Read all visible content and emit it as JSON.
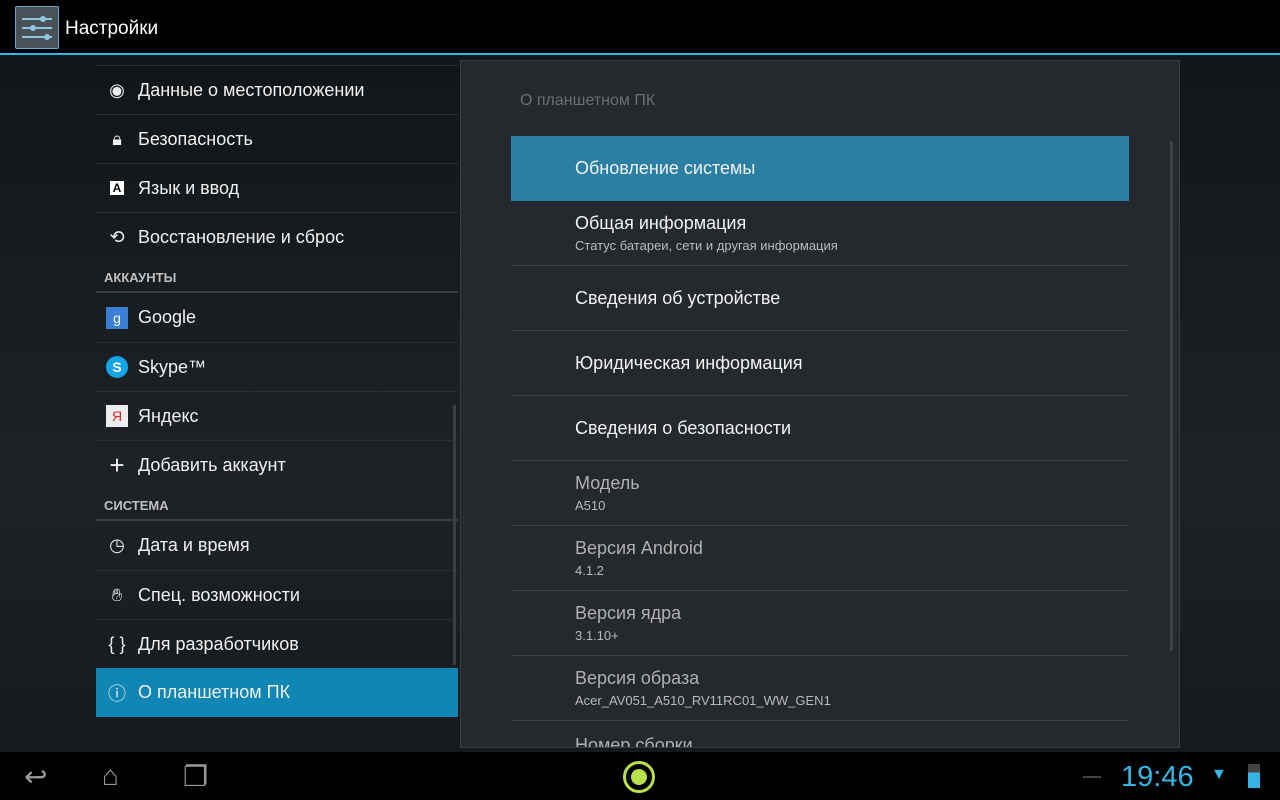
{
  "app": {
    "title": "Настройки"
  },
  "left": {
    "items": [
      {
        "label": "Данные о местоположении",
        "icon": "location-icon"
      },
      {
        "label": "Безопасность",
        "icon": "lock-icon"
      },
      {
        "label": "Язык и ввод",
        "icon": "keyboard-a-icon"
      },
      {
        "label": "Восстановление и сброс",
        "icon": "restore-icon"
      }
    ],
    "accounts_header": "АККАУНТЫ",
    "accounts": [
      {
        "label": "Google",
        "icon": "google-icon"
      },
      {
        "label": "Skype™",
        "icon": "skype-icon"
      },
      {
        "label": "Яндекс",
        "icon": "yandex-icon"
      },
      {
        "label": "Добавить аккаунт",
        "icon": "plus-icon"
      }
    ],
    "system_header": "СИСТЕМА",
    "system": [
      {
        "label": "Дата и время",
        "icon": "clock-icon"
      },
      {
        "label": "Спец. возможности",
        "icon": "hand-icon"
      },
      {
        "label": "Для разработчиков",
        "icon": "braces-icon"
      },
      {
        "label": "О планшетном ПК",
        "icon": "info-icon"
      }
    ]
  },
  "panel": {
    "title": "О планшетном ПК",
    "items": [
      {
        "title": "Обновление системы"
      },
      {
        "title": "Общая информация",
        "sub": "Статус батареи, сети и другая информация"
      },
      {
        "title": "Сведения об устройстве"
      },
      {
        "title": "Юридическая информация"
      },
      {
        "title": "Сведения о безопасности"
      },
      {
        "title": "Модель",
        "sub": "A510"
      },
      {
        "title": "Версия Android",
        "sub": "4.1.2"
      },
      {
        "title": "Версия ядра",
        "sub": "3.1.10+"
      },
      {
        "title": "Версия образа",
        "sub": "Acer_AV051_A510_RV11RC01_WW_GEN1"
      },
      {
        "title": "Номер сборки"
      }
    ]
  },
  "status": {
    "time": "19:46"
  }
}
